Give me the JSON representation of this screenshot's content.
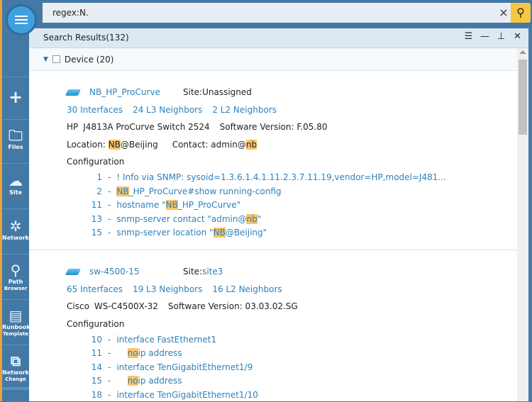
{
  "search": {
    "value": "regex:N.",
    "clear": "×",
    "go": "search"
  },
  "sidebar": {
    "items": [
      {
        "label": "",
        "icon": "plus"
      },
      {
        "label": "Files"
      },
      {
        "label": "Site"
      },
      {
        "label": "Network"
      },
      {
        "label": "Path",
        "label2": "Browser"
      },
      {
        "label": "Runbook",
        "label2": "Template"
      },
      {
        "label": "Network",
        "label2": "Change"
      }
    ]
  },
  "panel": {
    "title": "Search Results(132)",
    "group": "Device (20)"
  },
  "colors": {
    "sidebar": "#4479a5",
    "highlight": "#f8c46a",
    "link": "#2f80b9",
    "search_button": "#f8c640"
  },
  "devices": [
    {
      "name": "NB_HP_ProCurve",
      "site_label": "Site: ",
      "site": "Unassigned",
      "interfaces": "30 Interfaces",
      "l3": "24 L3 Neighbors",
      "l2": "2 L2 Neighbors",
      "vendor": "HP",
      "model": "J4813A ProCurve Switch 2524",
      "software": "Software Version: F.05.80",
      "location_label": "Location: ",
      "location_hl": "NB",
      "location_rest": "@Beijing",
      "contact_label": "Contact: admin@",
      "contact_hl": "nb",
      "config_label": "Configuration",
      "config": [
        {
          "n": "1",
          "pre": "! Info via SNMP: sysoid=1.3.6.1.4.1.11.2.3.7.11.19,vendor=HP,model=J481...",
          "hl": "",
          "post": ""
        },
        {
          "n": "2",
          "pre": "",
          "hl": "NB",
          "post": "_HP_ProCurve#show running-config"
        },
        {
          "n": "11",
          "pre": "hostname \"",
          "hl": "NB",
          "post": "_HP_ProCurve\""
        },
        {
          "n": "13",
          "pre": "snmp-server contact \"admin@",
          "hl": "nb",
          "post": "\""
        },
        {
          "n": "15",
          "pre": "snmp-server location \"",
          "hl": "NB",
          "post": "@Beijing\""
        }
      ]
    },
    {
      "name": "sw-4500-15",
      "site_label": "Site: ",
      "site": "site3",
      "interfaces": "65 Interfaces",
      "l3": "19 L3 Neighbors",
      "l2": "16 L2 Neighbors",
      "vendor": "Cisco",
      "model": "WS-C4500X-32",
      "software": "Software Version: 03.03.02.SG",
      "config_label": "Configuration",
      "config": [
        {
          "n": "10",
          "pre": "interface FastEthernet1",
          "hl": "",
          "post": ""
        },
        {
          "n": "11",
          "pre": "    ",
          "hl": "no",
          "post": " ip address"
        },
        {
          "n": "14",
          "pre": "interface TenGigabitEthernet1/9",
          "hl": "",
          "post": ""
        },
        {
          "n": "15",
          "pre": "    ",
          "hl": "no",
          "post": " ip address"
        },
        {
          "n": "18",
          "pre": "interface TenGigabitEthernet1/10",
          "hl": "",
          "post": ""
        }
      ]
    }
  ]
}
